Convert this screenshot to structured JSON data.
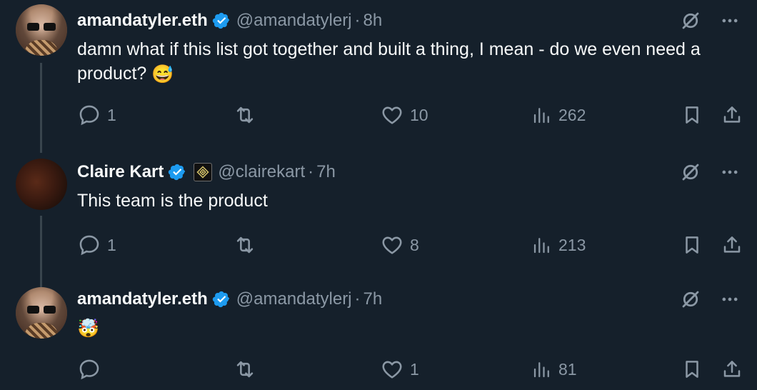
{
  "tweets": [
    {
      "display_name": "amandatyler.eth",
      "handle": "@amandatylerj",
      "separator": "·",
      "time": "8h",
      "text": "damn what if this list got together and built a thing, I mean - do we even need a product?",
      "emoji": "😅",
      "replies": "1",
      "retweets": "",
      "likes": "10",
      "views": "262"
    },
    {
      "display_name": "Claire Kart",
      "handle": "@clairekart",
      "separator": "·",
      "time": "7h",
      "text": "This team is the product",
      "emoji": "",
      "replies": "1",
      "retweets": "",
      "likes": "8",
      "views": "213"
    },
    {
      "display_name": "amandatyler.eth",
      "handle": "@amandatylerj",
      "separator": "·",
      "time": "7h",
      "text": "",
      "emoji": "🤯",
      "replies": "",
      "retweets": "",
      "likes": "1",
      "views": "81"
    }
  ],
  "icons": {
    "verified": "verified-badge-icon",
    "affiliate": "affiliate-badge-icon",
    "grok": "grok-icon",
    "more": "more-icon",
    "reply": "reply-icon",
    "retweet": "retweet-icon",
    "like": "heart-icon",
    "views": "views-icon",
    "bookmark": "bookmark-icon",
    "share": "share-icon"
  },
  "colors": {
    "background": "#15202b",
    "text": "#f7f9f9",
    "secondary": "#8b98a5",
    "verified": "#1d9bf0",
    "thread_line": "#38444d"
  }
}
